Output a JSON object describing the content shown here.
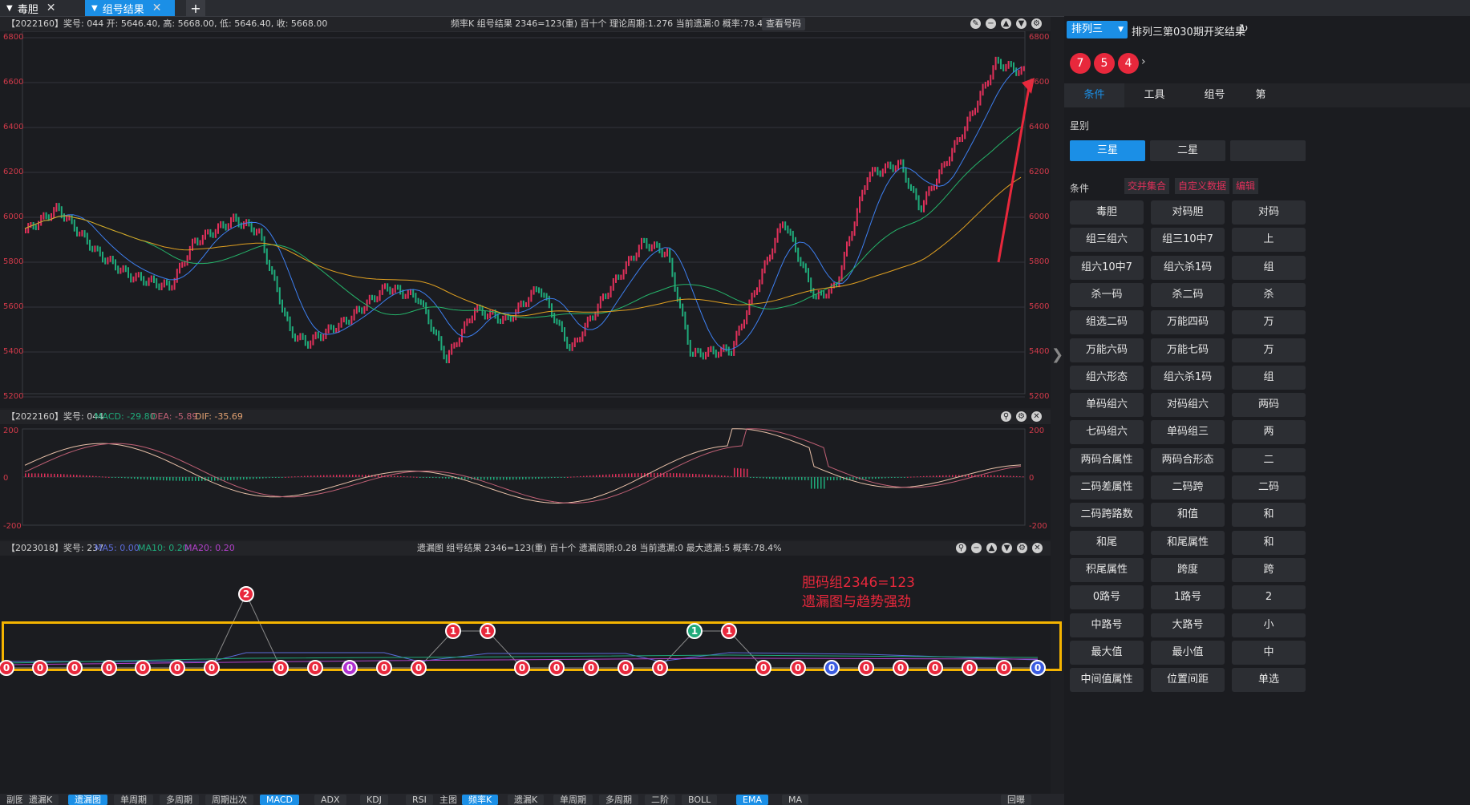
{
  "tabs": [
    {
      "label": "毒胆",
      "active": false
    },
    {
      "label": "组号结果",
      "active": true
    }
  ],
  "tab_add": "+",
  "main_chart": {
    "header": "【2022160】奖号: 044  开: 5646.40, 高: 5668.00, 低: 5646.40, 收: 5668.00",
    "info": "频率K  组号结果  2346=123(重)  百十个  理论周期:1.276  当前遗漏:0  概率:78.4%",
    "view_button": "查看号码",
    "y_ticks": [
      "6800",
      "6600",
      "6400",
      "6200",
      "6000",
      "5800",
      "5600",
      "5400",
      "5200"
    ]
  },
  "macd_chart": {
    "header_prefix": "【2022160】奖号: 044",
    "macd": "MACD: -29.80",
    "dea": "DEA: -5.89",
    "dif": "DIF: -35.69",
    "y_ticks": [
      "200",
      "0",
      "-200"
    ]
  },
  "miss_chart": {
    "header_prefix": "【2023018】奖号: 237",
    "ma5": "MA5: 0.00",
    "ma10": "MA10: 0.20",
    "ma20": "MA20: 0.20",
    "info": "遗漏图  组号结果  2346=123(重)  百十个  遗漏周期:0.28  当前遗漏:0  最大遗漏:5  概率:78.4%",
    "annotation_line1": "胆码组2346=123",
    "annotation_line2": "遗漏图与趋势强劲",
    "nodes": [
      "0",
      "0",
      "0",
      "0",
      "0",
      "0",
      "0",
      "2",
      "0",
      "0",
      "0",
      "0",
      "0",
      "1",
      "1",
      "0",
      "0",
      "0",
      "0",
      "0",
      "1",
      "1",
      "0",
      "0",
      "0",
      "0",
      "0",
      "0",
      "0",
      "0",
      "0"
    ]
  },
  "sidebar": {
    "lottery_select": "排列三",
    "result_title": "排列三第030期开奖结果",
    "balls": [
      "7",
      "5",
      "4"
    ],
    "tabs": [
      "条件",
      "工具",
      "组号",
      "第"
    ],
    "section_star": "星别",
    "star_options": [
      "三星",
      "二星"
    ],
    "section_condition": "条件",
    "condition_links": [
      "交并集合",
      "自定义数据",
      "编辑"
    ],
    "buttons": [
      [
        "毒胆",
        "对码胆",
        "对码"
      ],
      [
        "组三组六",
        "组三10中7",
        "上"
      ],
      [
        "组六10中7",
        "组六杀1码",
        "组"
      ],
      [
        "杀一码",
        "杀二码",
        "杀"
      ],
      [
        "组选二码",
        "万能四码",
        "万"
      ],
      [
        "万能六码",
        "万能七码",
        "万"
      ],
      [
        "组六形态",
        "组六杀1码",
        "组"
      ],
      [
        "单码组六",
        "对码组六",
        "两码"
      ],
      [
        "七码组六",
        "单码组三",
        "两"
      ],
      [
        "两码合属性",
        "两码合形态",
        "二"
      ],
      [
        "二码差属性",
        "二码跨",
        "二码"
      ],
      [
        "二码跨路数",
        "和值",
        "和"
      ],
      [
        "和尾",
        "和尾属性",
        "和"
      ],
      [
        "积尾属性",
        "跨度",
        "跨"
      ],
      [
        "0路号",
        "1路号",
        "2"
      ],
      [
        "中路号",
        "大路号",
        "小"
      ],
      [
        "最大值",
        "最小值",
        "中"
      ],
      [
        "中间值属性",
        "位置间距",
        "单选"
      ]
    ]
  },
  "toolbar": {
    "left_label": "副图",
    "left_items": [
      "遗漏K",
      "遗漏图",
      "单周期",
      "多周期",
      "周期出次",
      "MACD",
      "ADX",
      "KDJ",
      "RSI"
    ],
    "left_active": [
      "遗漏图",
      "MACD"
    ],
    "mid_label": "主图",
    "mid_items": [
      "频率K",
      "遗漏K",
      "单周期",
      "多周期",
      "二阶",
      "BOLL",
      "EMA",
      "MA"
    ],
    "mid_active": [
      "频率K",
      "EMA"
    ],
    "right_item": "回曝"
  },
  "colors": {
    "accent": "#1b8fe6",
    "up": "#e0305a",
    "down": "#1faa7a",
    "ball": "#e8283c",
    "highlight": "#f5b400"
  }
}
